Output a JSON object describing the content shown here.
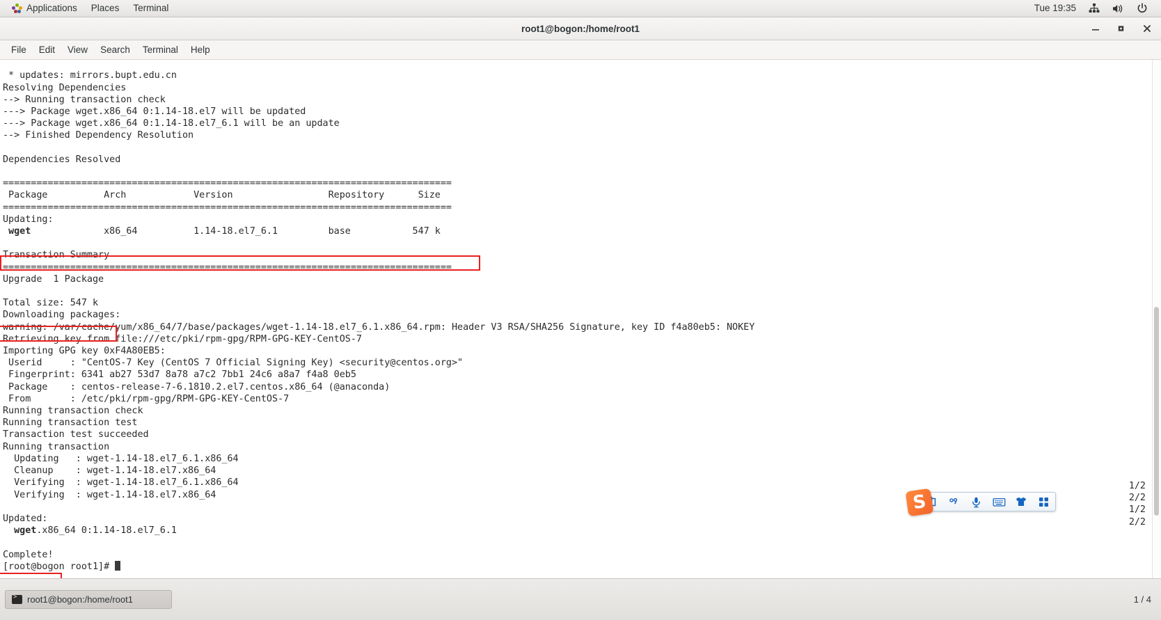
{
  "gnome_panel": {
    "menus": [
      "Applications",
      "Places",
      "Terminal"
    ],
    "clock": "Tue 19:35",
    "tray_icons": [
      "network-icon",
      "volume-icon",
      "power-icon"
    ]
  },
  "window": {
    "title": "root1@bogon:/home/root1",
    "controls": {
      "minimize": "minimize-button",
      "maximize": "maximize-button",
      "close": "close-button"
    },
    "menubar": [
      "File",
      "Edit",
      "View",
      "Search",
      "Terminal",
      "Help"
    ]
  },
  "terminal": {
    "lines": [
      " * updates: mirrors.bupt.edu.cn",
      "Resolving Dependencies",
      "--> Running transaction check",
      "---> Package wget.x86_64 0:1.14-18.el7 will be updated",
      "---> Package wget.x86_64 0:1.14-18.el7_6.1 will be an update",
      "--> Finished Dependency Resolution",
      "",
      "Dependencies Resolved",
      "",
      "================================================================================",
      " Package          Arch            Version                 Repository      Size",
      "================================================================================",
      "Updating:",
      " wget             x86_64          1.14-18.el7_6.1         base           547 k",
      "",
      "Transaction Summary",
      "================================================================================",
      "Upgrade  1 Package",
      "",
      "Total size: 547 k",
      "Downloading packages:",
      "warning: /var/cache/yum/x86_64/7/base/packages/wget-1.14-18.el7_6.1.x86_64.rpm: Header V3 RSA/SHA256 Signature, key ID f4a80eb5: NOKEY",
      "Retrieving key from file:///etc/pki/rpm-gpg/RPM-GPG-KEY-CentOS-7",
      "Importing GPG key 0xF4A80EB5:",
      " Userid     : \"CentOS-7 Key (CentOS 7 Official Signing Key) <security@centos.org>\"",
      " Fingerprint: 6341 ab27 53d7 8a78 a7c2 7bb1 24c6 a8a7 f4a8 0eb5",
      " Package    : centos-release-7-6.1810.2.el7.centos.x86_64 (@anaconda)",
      " From       : /etc/pki/rpm-gpg/RPM-GPG-KEY-CentOS-7",
      "Running transaction check",
      "Running transaction test",
      "Transaction test succeeded",
      "Running transaction",
      "  Updating   : wget-1.14-18.el7_6.1.x86_64",
      "  Cleanup    : wget-1.14-18.el7.x86_64",
      "  Verifying  : wget-1.14-18.el7_6.1.x86_64",
      "  Verifying  : wget-1.14-18.el7.x86_64",
      "",
      "Updated:",
      "  wget.x86_64 0:1.14-18.el7_6.1",
      "",
      "Complete!"
    ],
    "bold_package_name": "wget",
    "progress_counters": [
      "1/2",
      "2/2",
      "1/2",
      "2/2"
    ],
    "prompt": "[root@bogon root1]# ",
    "annotation_color": "#e8201f",
    "annotations": [
      {
        "name": "wget-package-row-highlight",
        "label": " wget             x86_64          1.14-18.el7_6.1         base           547 k"
      },
      {
        "name": "total-size-highlight",
        "label": "Total size: 547 k"
      },
      {
        "name": "complete-highlight",
        "label": "Complete!"
      }
    ]
  },
  "ime": {
    "name": "sogou-input-method",
    "logo": "S",
    "items": [
      {
        "name": "chinese-mode-icon",
        "glyph": "中"
      },
      {
        "name": "punctuation-mode-icon",
        "glyph": "°,"
      },
      {
        "name": "voice-input-icon",
        "glyph": "🎤"
      },
      {
        "name": "soft-keyboard-icon",
        "glyph": "⌨"
      },
      {
        "name": "skin-icon",
        "glyph": "👕"
      },
      {
        "name": "toolbox-icon",
        "glyph": "▦"
      }
    ]
  },
  "taskbar": {
    "task_label": "root1@bogon:/home/root1",
    "workspace": "1 / 4"
  }
}
